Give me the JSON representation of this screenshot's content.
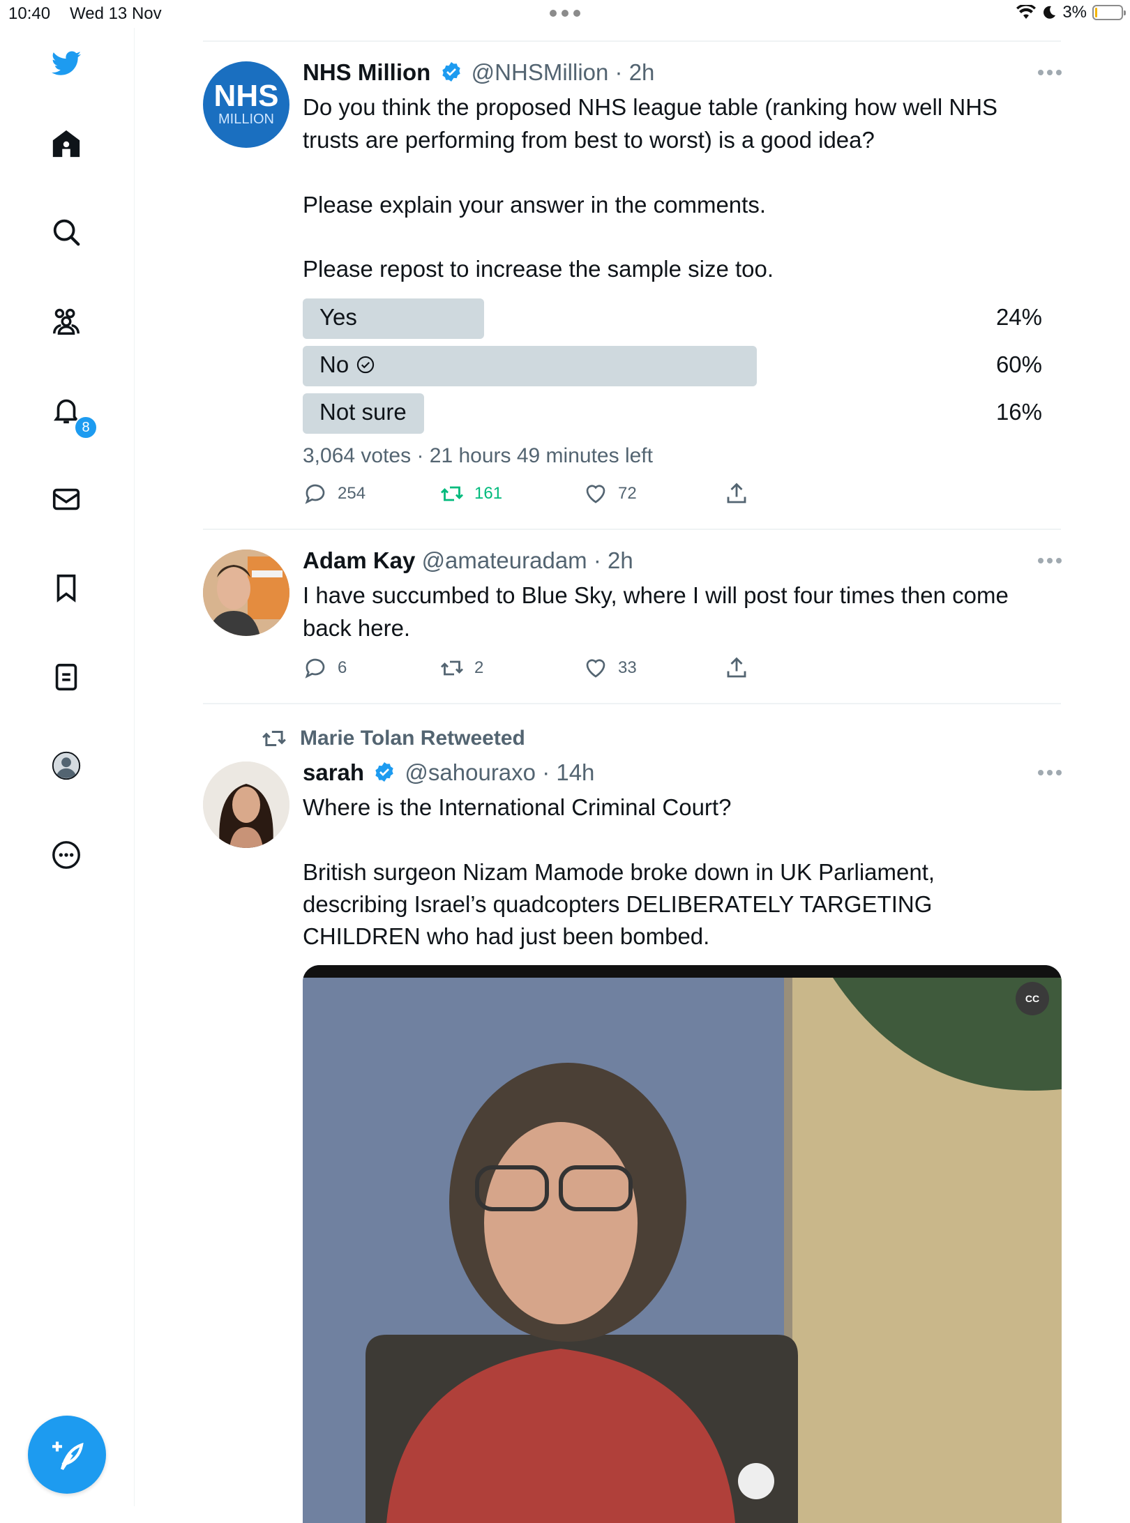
{
  "status_bar": {
    "time": "10:40",
    "date": "Wed 13 Nov",
    "battery": "3%"
  },
  "sidebar": {
    "items": [
      "Home",
      "Search",
      "Communities",
      "Notifications",
      "Messages",
      "Bookmarks",
      "Lists",
      "Profile",
      "More"
    ],
    "notification_count": "8"
  },
  "tweets": [
    {
      "name": "NHS Million",
      "handle": "@NHSMillion",
      "time": "· 2h",
      "avatar_text": {
        "line1": "NHS",
        "line2": "MILLION"
      },
      "text": [
        "Do you think the proposed NHS league table (ranking how well NHS",
        "trusts are performing from best to worst) is a good idea?",
        "Please explain your answer in the comments.",
        "Please repost to increase the sample size too."
      ],
      "poll": [
        {
          "label": "Yes",
          "pct": "24%",
          "fraction": 0.24
        },
        {
          "label": "No",
          "pct": "60%",
          "fraction": 0.6,
          "selected": true
        },
        {
          "label": "Not sure",
          "pct": "16%",
          "fraction": 0.16
        }
      ],
      "poll_meta": "3,064 votes · 21 hours 49 minutes left",
      "replies": "254",
      "retweets": "161",
      "likes": "72"
    },
    {
      "name": "Adam Kay",
      "handle": "@amateuradam",
      "time": "· 2h",
      "text": [
        "I have succumbed to Blue Sky, where I will post four times then come",
        "back here."
      ],
      "replies": "6",
      "retweets": "2",
      "likes": "33"
    },
    {
      "retweeted_by": "Marie Tolan Retweeted",
      "name": "sarah",
      "handle": "@sahouraxo",
      "time": "· 14h",
      "text": [
        "Where is the International Criminal Court?",
        "British surgeon Nizam Mamode broke down in UK Parliament,",
        "describing Israel’s quadcopters DELIBERATELY TARGETING",
        "CHILDREN who had just been bombed."
      ],
      "video_cc": "CC"
    }
  ],
  "colors": {
    "accent": "#1d9bf0",
    "retweet_active": "#00ba7c",
    "poll_bar": "#cfd9de",
    "secondary_text": "#536471"
  }
}
